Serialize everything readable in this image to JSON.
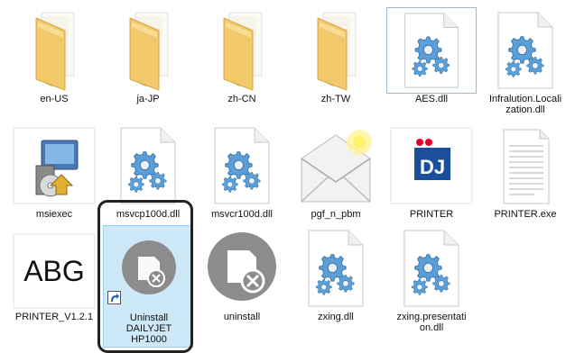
{
  "files": [
    {
      "name": "en-US",
      "icon": "folder-icon"
    },
    {
      "name": "ja-JP",
      "icon": "folder-icon"
    },
    {
      "name": "zh-CN",
      "icon": "folder-icon"
    },
    {
      "name": "zh-TW",
      "icon": "folder-icon"
    },
    {
      "name": "AES.dll",
      "icon": "dll-gear-icon"
    },
    {
      "name": "Infralution.Locali\nzation.dll",
      "icon": "dll-gear-icon"
    },
    {
      "name": "msiexec",
      "icon": "installer-icon"
    },
    {
      "name": "msvcp100d.dll",
      "icon": "dll-gear-icon"
    },
    {
      "name": "msvcr100d.dll",
      "icon": "dll-gear-icon"
    },
    {
      "name": "pgf_n_pbm",
      "icon": "mail-envelope-icon"
    },
    {
      "name": "PRINTER",
      "icon": "dj-app-icon",
      "icon_text": "DJ"
    },
    {
      "name": "PRINTER.exe",
      "icon": "text-document-icon"
    },
    {
      "name": "PRINTER_V1.2.1",
      "icon": "font-file-icon",
      "icon_text": "ABG"
    },
    {
      "name": "Uninstall\nDAILYJET\nHP1000",
      "icon": "uninstall-shortcut-icon"
    },
    {
      "name": "uninstall",
      "icon": "uninstall-icon"
    },
    {
      "name": "zxing.dll",
      "icon": "dll-gear-icon"
    },
    {
      "name": "zxing.presentati\non.dll",
      "icon": "dll-gear-icon"
    }
  ],
  "colors": {
    "folder": "#f2c96a",
    "selection": "#cde8f7",
    "dj_red": "#e4002b",
    "dj_blue": "#1b4f9c",
    "gear": "#5b9fd6"
  }
}
